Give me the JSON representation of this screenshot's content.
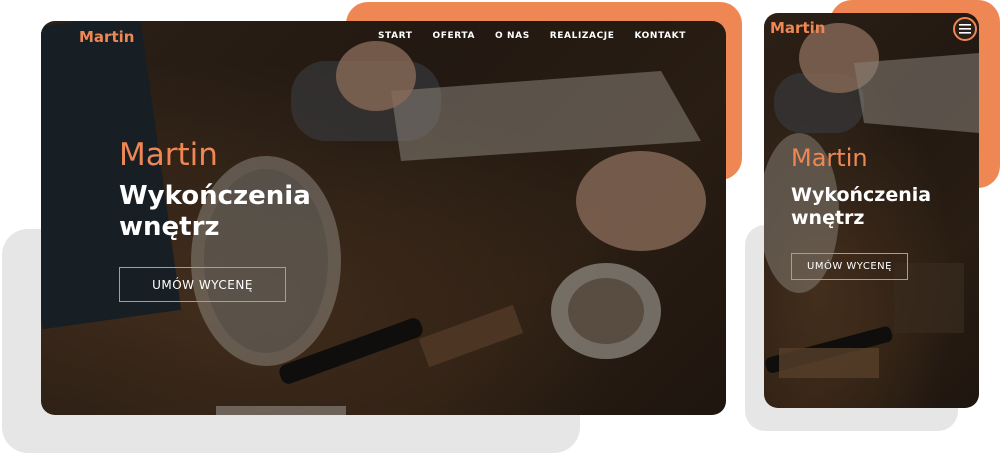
{
  "desktop": {
    "brand": "Martin",
    "nav": [
      "START",
      "OFERTA",
      "O NAS",
      "REALIZACJE",
      "KONTAKT"
    ],
    "hero_name": "Martin",
    "hero_title": "Wykończenia\nwnętrz",
    "cta_label": "UMÓW WYCENĘ"
  },
  "mobile": {
    "brand": "Martin",
    "menu_icon": "hamburger-icon",
    "hero_name": "Martin",
    "hero_title": "Wykończenia\nwnętrz",
    "cta_label": "UMÓW WYCENĘ"
  },
  "colors": {
    "accent": "#ef8754",
    "grey_backdrop": "#e6e6e6",
    "text": "#ffffff"
  }
}
